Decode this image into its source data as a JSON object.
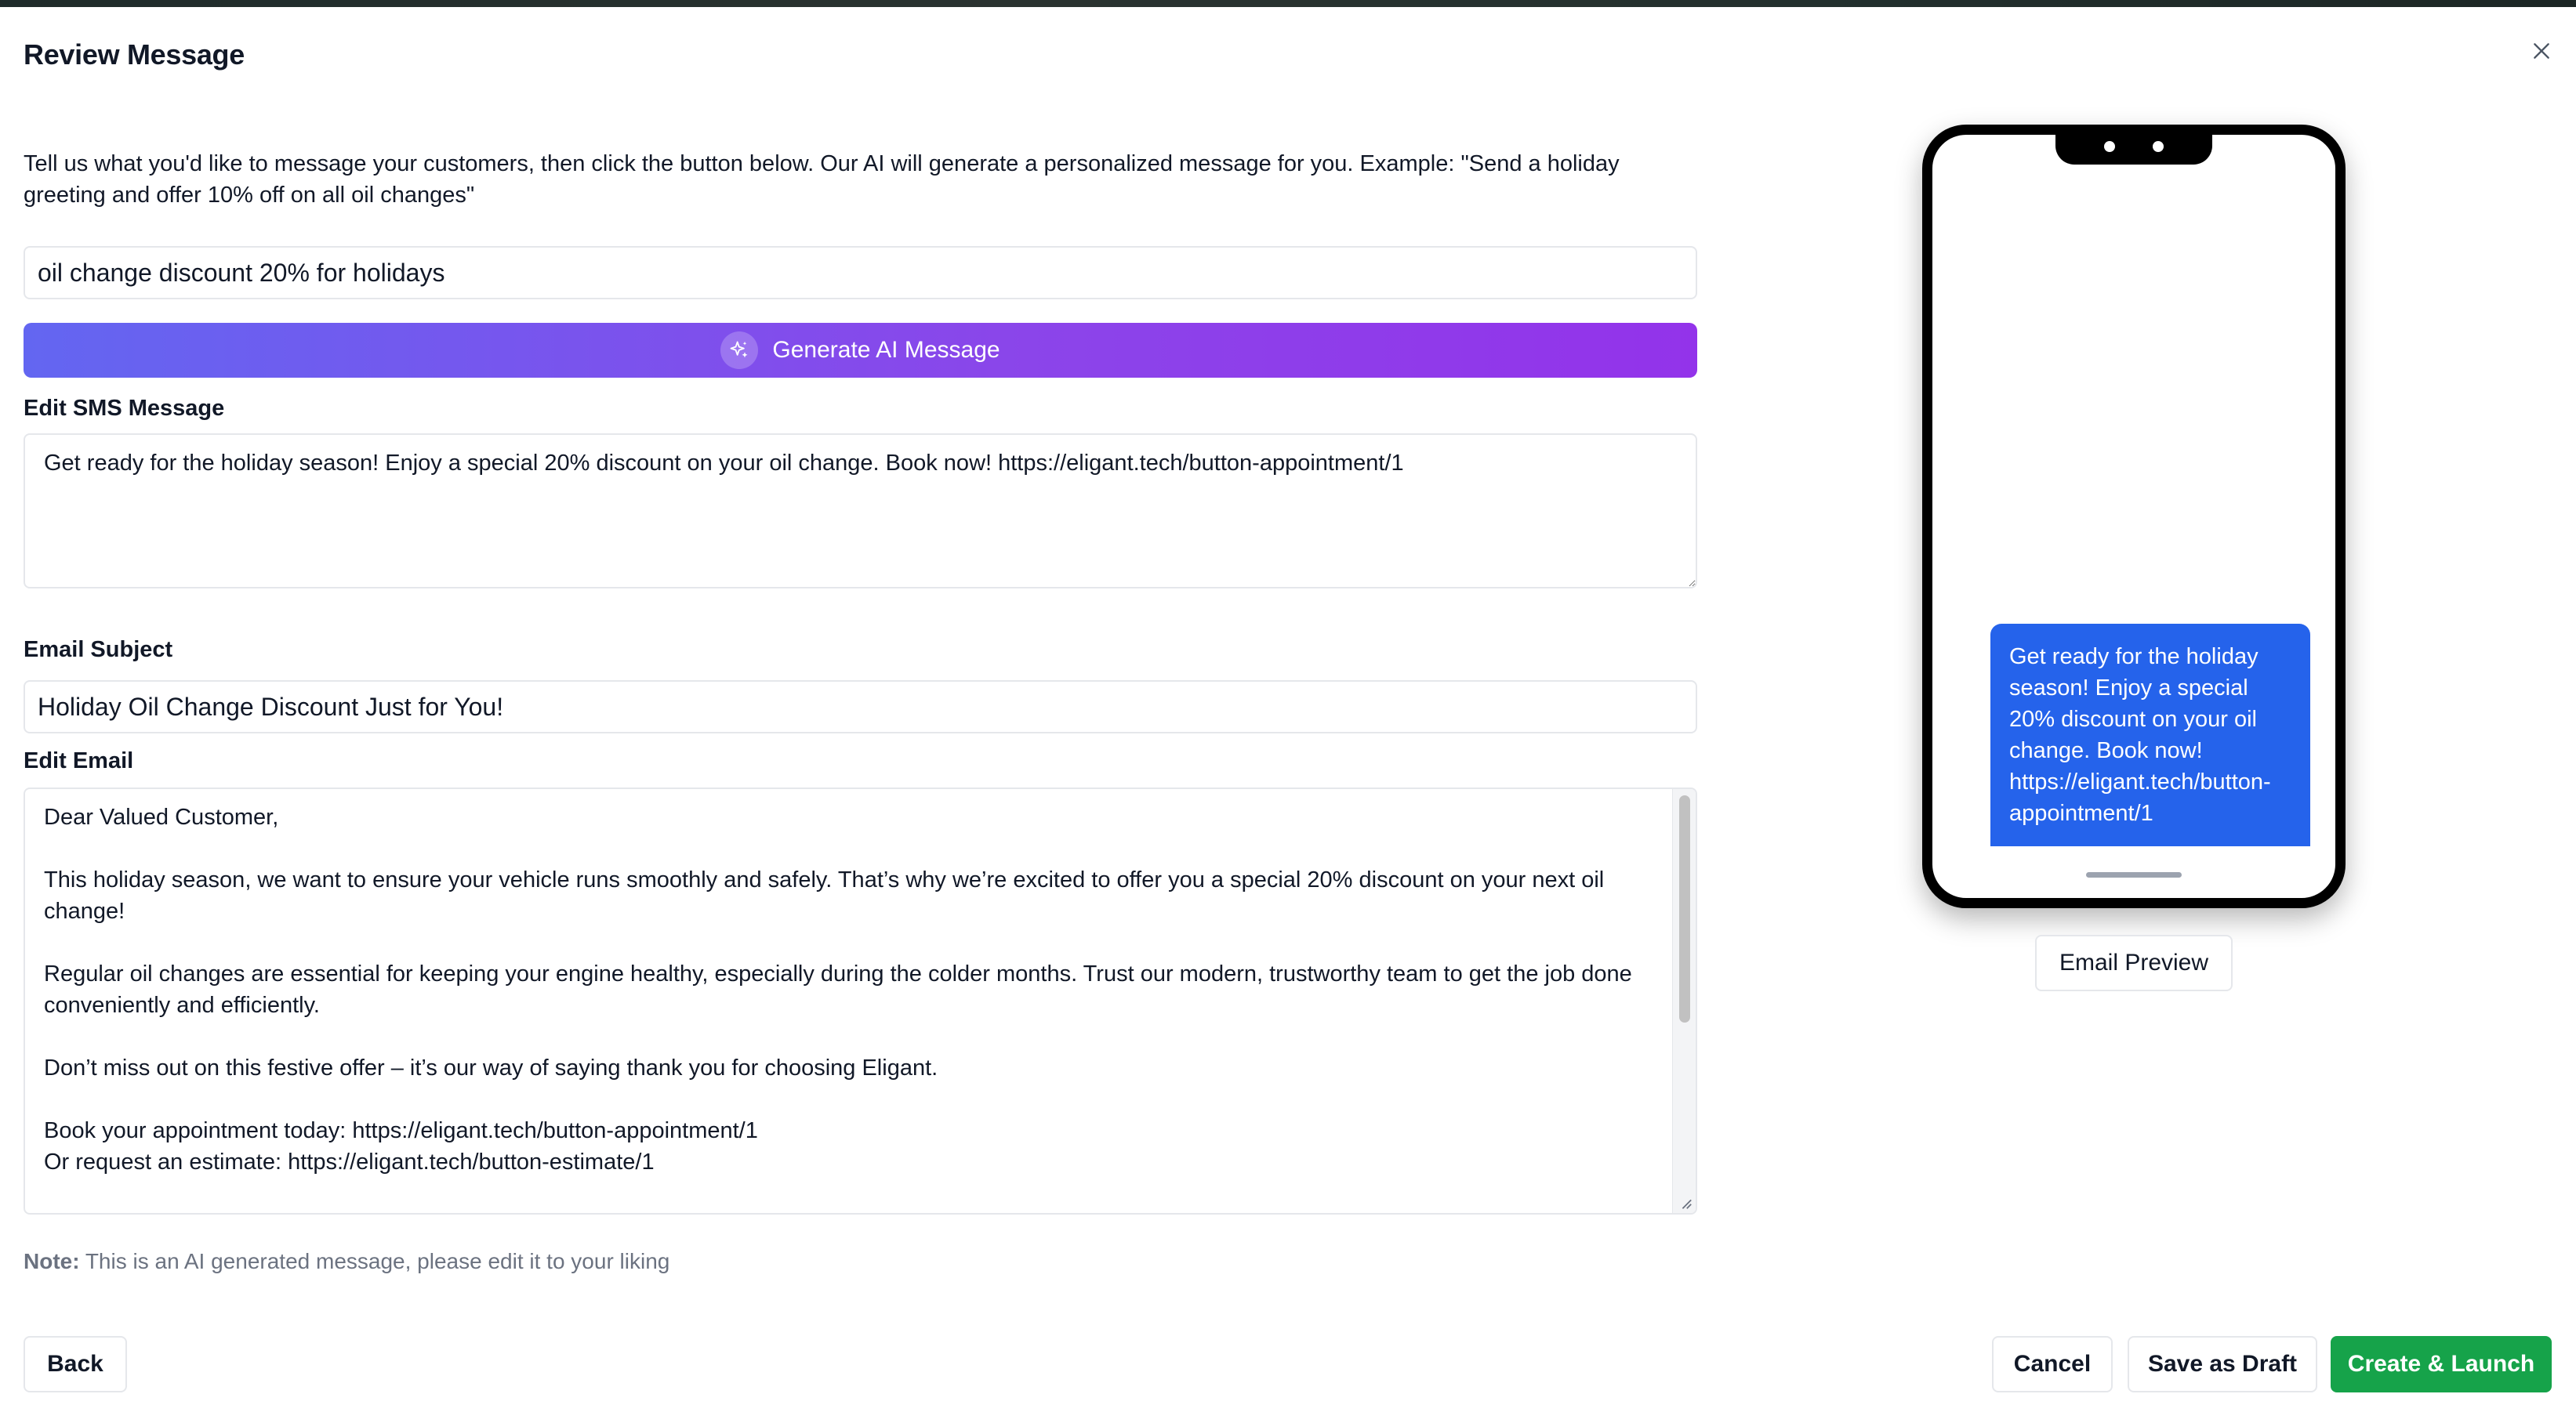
{
  "modal": {
    "title": "Review Message",
    "close_icon": "close-icon"
  },
  "form": {
    "instructions": "Tell us what you'd like to message your customers, then click the button below. Our AI will generate a personalized message for you. Example: \"Send a holiday greeting and offer 10% off on all oil changes\"",
    "prompt_value": "oil change discount 20% for holidays",
    "generate_label": "Generate AI Message",
    "generate_icon": "sparkles-icon",
    "sms_label": "Edit SMS Message",
    "sms_value": "Get ready for the holiday season! Enjoy a special 20% discount on your oil change. Book now! https://eligant.tech/button-appointment/1",
    "subject_label": "Email Subject",
    "subject_value": "Holiday Oil Change Discount Just for You!",
    "email_label": "Edit Email",
    "email_value": "Dear Valued Customer,\n\nThis holiday season, we want to ensure your vehicle runs smoothly and safely. That’s why we’re excited to offer you a special 20% discount on your next oil change!\n\nRegular oil changes are essential for keeping your engine healthy, especially during the colder months. Trust our modern, trustworthy team to get the job done conveniently and efficiently.\n\nDon’t miss out on this festive offer – it’s our way of saying thank you for choosing Eligant.\n\nBook your appointment today: https://eligant.tech/button-appointment/1\nOr request an estimate: https://eligant.tech/button-estimate/1",
    "note_label": "Note:",
    "note_text": " This is an AI generated message, please edit it to your liking"
  },
  "preview": {
    "sms_bubble": "Get ready for the holiday season! Enjoy a special 20% discount on your oil change. Book now! https://eligant.tech/button-appointment/1",
    "email_preview_label": "Email Preview"
  },
  "footer": {
    "back_label": "Back",
    "cancel_label": "Cancel",
    "draft_label": "Save as Draft",
    "launch_label": "Create & Launch"
  },
  "colors": {
    "primary_gradient_start": "#6366f1",
    "primary_gradient_end": "#9333ea",
    "launch_green": "#16a34a",
    "bubble_blue": "#2563eb"
  }
}
